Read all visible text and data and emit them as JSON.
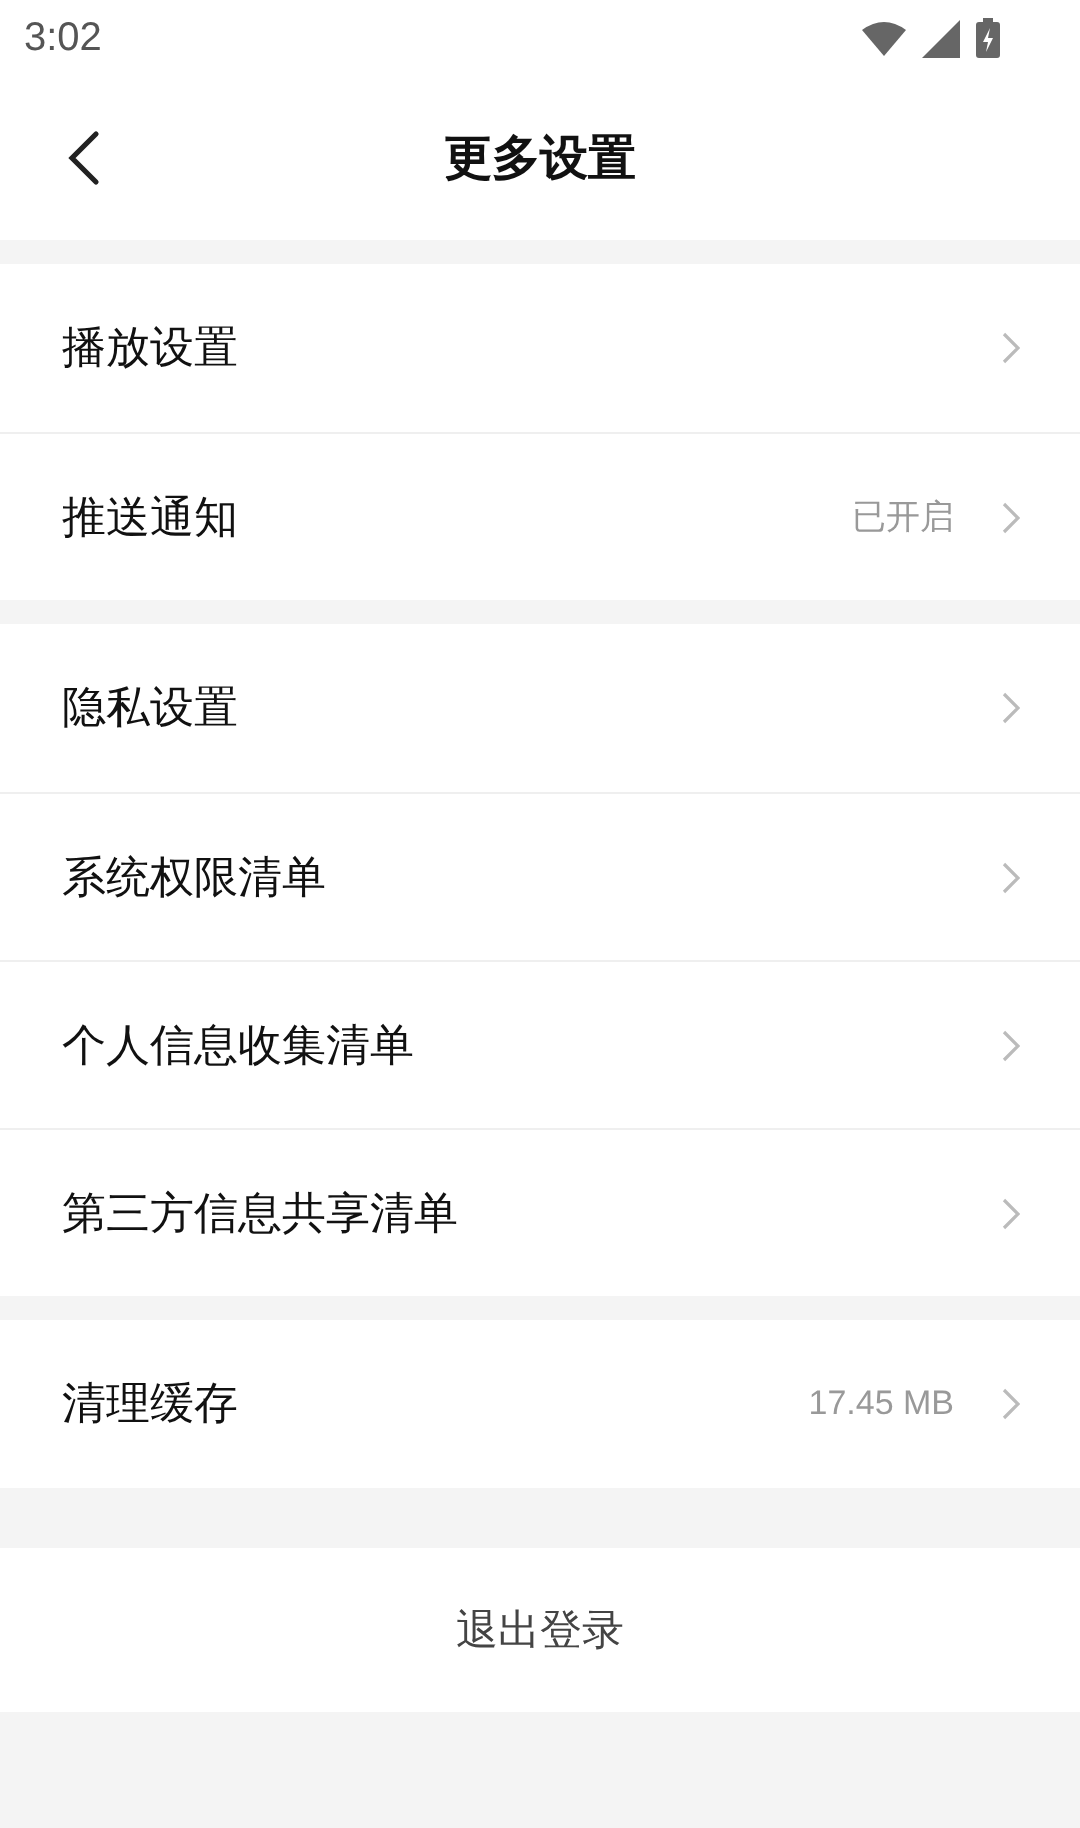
{
  "status_bar": {
    "time": "3:02"
  },
  "header": {
    "title": "更多设置"
  },
  "groups": [
    {
      "items": [
        {
          "label": "播放设置"
        },
        {
          "label": "推送通知",
          "value": "已开启"
        }
      ]
    },
    {
      "items": [
        {
          "label": "隐私设置"
        },
        {
          "label": "系统权限清单"
        },
        {
          "label": "个人信息收集清单"
        },
        {
          "label": "第三方信息共享清单"
        }
      ]
    },
    {
      "items": [
        {
          "label": "清理缓存",
          "value": "17.45 MB"
        }
      ]
    }
  ],
  "logout_button": "退出登录"
}
